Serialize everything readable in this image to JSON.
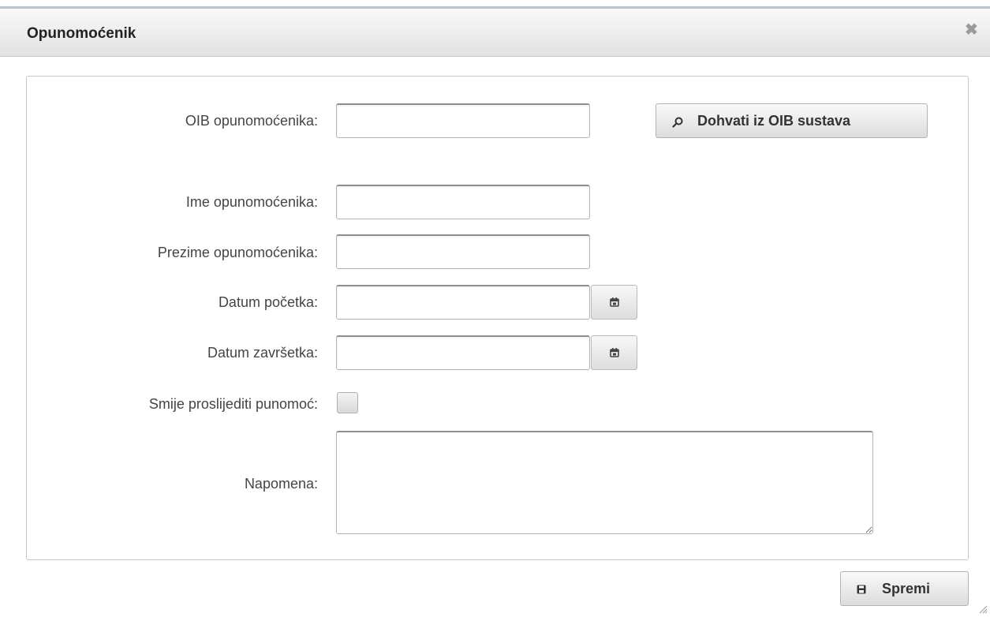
{
  "dialog": {
    "title": "Opunomoćenik",
    "close_icon": "close-icon"
  },
  "form": {
    "oib_label": "OIB opunomoćenika:",
    "oib_value": "",
    "lookup_button_label": "Dohvati iz OIB sustava",
    "lookup_icon": "search-icon",
    "first_name_label": "Ime opunomoćenika:",
    "first_name_value": "",
    "last_name_label": "Prezime opunomoćenika:",
    "last_name_value": "",
    "start_date_label": "Datum početka:",
    "start_date_value": "",
    "end_date_label": "Datum završetka:",
    "end_date_value": "",
    "calendar_icon": "calendar-icon",
    "forward_label": "Smije proslijediti punomoć:",
    "forward_checked": false,
    "note_label": "Napomena:",
    "note_value": ""
  },
  "footer": {
    "save_label": "Spremi",
    "save_icon": "save-icon"
  }
}
